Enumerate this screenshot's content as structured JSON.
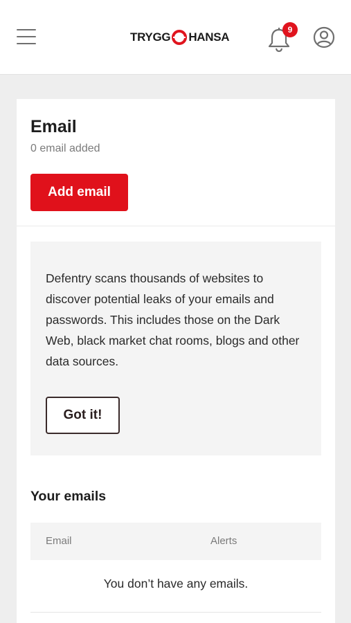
{
  "header": {
    "logo_left": "TRYGG",
    "logo_right": "HANSA",
    "notification_count": "9",
    "brand_color": "#e0141e"
  },
  "email_section": {
    "title": "Email",
    "subtitle": "0 email added",
    "add_button": "Add email"
  },
  "info_box": {
    "text": "Defentry scans thousands of websites to discover potential leaks of your emails and passwords. This includes those on the Dark Web, black market chat rooms, blogs and other data sources.",
    "button": "Got it!"
  },
  "your_emails": {
    "heading": "Your emails",
    "columns": [
      "Email",
      "Alerts"
    ],
    "empty_message": "You don’t have any emails."
  },
  "icons": [
    "menu-icon",
    "bell-icon",
    "account-icon",
    "lifebuoy-icon"
  ]
}
